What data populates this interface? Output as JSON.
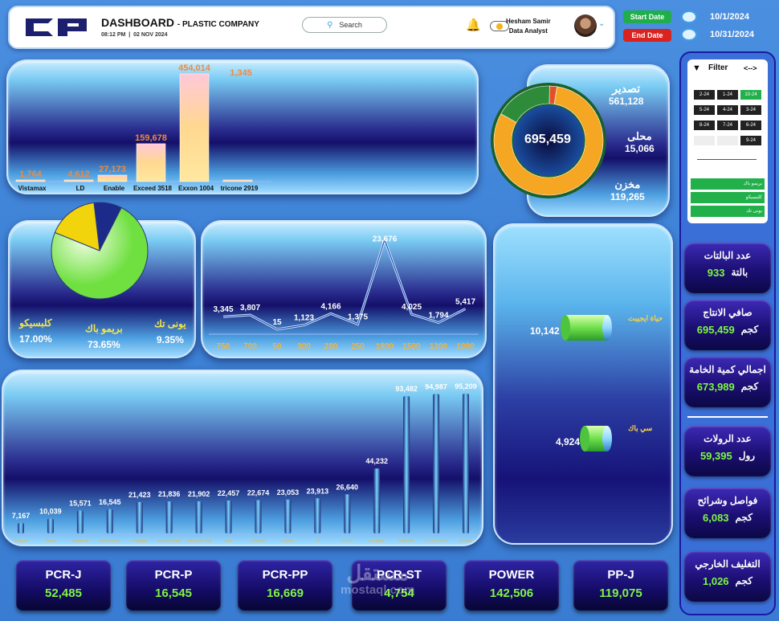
{
  "header": {
    "title": "DASHBOARD",
    "company": "- PLASTIC COMPANY",
    "time": "08:12 PM",
    "date": "02 NOV 2024",
    "search_label": "Search",
    "user_name": "Hesham Samir",
    "user_role": "Data Analyst"
  },
  "date_range": {
    "start_label": "Start Date",
    "end_label": "End Date",
    "start_value": "10/1/2024",
    "end_value": "10/31/2024",
    "start_color": "#1fae4a",
    "end_color": "#d8231f"
  },
  "filter": {
    "title": "Filter",
    "arrows": "<-->",
    "months": [
      "2-24",
      "1-24",
      "10-24",
      "5-24",
      "4-24",
      "3-24",
      "8-24",
      "7-24",
      "6-24",
      "",
      "",
      "9-24"
    ],
    "selected": "10-24",
    "items": [
      "بريمو باك",
      "كلبسيكو",
      "يونى تك"
    ]
  },
  "kpis": [
    {
      "title": "عدد البالتات",
      "value": "933",
      "unit": "بالتة"
    },
    {
      "title": "صافي الانتاج",
      "value": "695,459",
      "unit": "كجم"
    },
    {
      "title": "اجمالي كمية الخامة",
      "value": "673,989",
      "unit": "كجم"
    },
    {
      "title": "عدد الرولات",
      "value": "59,395",
      "unit": "رول"
    },
    {
      "title": "فواصل وشرائح",
      "value": "6,083",
      "unit": "كجم"
    },
    {
      "title": "التغليف الخارجي",
      "value": "1,026",
      "unit": "كجم"
    }
  ],
  "bottom_cards": [
    {
      "title": "PCR-J",
      "value": "52,485"
    },
    {
      "title": "PCR-P",
      "value": "16,545"
    },
    {
      "title": "PCR-PP",
      "value": "16,669"
    },
    {
      "title": "PCR-ST",
      "value": "4,754"
    },
    {
      "title": "POWER",
      "value": "142,506"
    },
    {
      "title": "PP-J",
      "value": "119,075"
    }
  ],
  "watermark": {
    "text": "mostaql.com",
    "arabic": "مستقل"
  },
  "donut": {
    "center_value": "695,459",
    "segments": [
      {
        "label": "تصدير",
        "value": "561,128",
        "num": 561128,
        "color": "#f5a623"
      },
      {
        "label": "محلى",
        "value": "15,066",
        "num": 15066,
        "color": "#e0502a"
      },
      {
        "label": "مخزن",
        "value": "119,265",
        "num": 119265,
        "color": "#2e8b3a"
      }
    ]
  },
  "pie": {
    "segments": [
      {
        "label": "كلبسيكو",
        "pct": "17.00%",
        "num": 17.0,
        "color": "#f2d40c"
      },
      {
        "label": "بريمو باك",
        "pct": "73.65%",
        "num": 73.65,
        "color": "#b8f58a"
      },
      {
        "label": "يونى تك",
        "pct": "9.35%",
        "num": 9.35,
        "color": "#1c2a8a"
      }
    ]
  },
  "cylinders": [
    {
      "label": "حياة ايجيبت",
      "value": "10,142"
    },
    {
      "label": "سي باك",
      "value": "4,924"
    }
  ],
  "chart_data": [
    {
      "type": "bar",
      "categories": [
        "Vistamax",
        "LD",
        "Enable",
        "Exceed 3518",
        "Exxon 1004",
        "tricone 2919"
      ],
      "values": [
        1764,
        4612,
        27173,
        159678,
        454014,
        1345
      ],
      "labels": [
        "1,764",
        "4,612",
        "27,173",
        "159,678",
        "454,014",
        "1,345"
      ]
    },
    {
      "type": "line",
      "categories": [
        "750",
        "700",
        "50",
        "300",
        "280",
        "250",
        "1800",
        "1500",
        "1300",
        "1000"
      ],
      "values": [
        3345,
        3807,
        15,
        1123,
        4166,
        1375,
        23676,
        4025,
        1794,
        5417
      ],
      "labels": [
        "3,345",
        "3,807",
        "15",
        "1,123",
        "4,166",
        "1,375",
        "23,676",
        "4,025",
        "1,794",
        "5,417"
      ]
    },
    {
      "type": "bar",
      "categories": [
        "Dubark",
        "Veres",
        "Plasticolo",
        "NOW PACK",
        "Prodigm",
        "SEADHIRAM",
        "Unilonnal Pack",
        "Amo",
        "PRIMAS",
        "Elixfeet",
        "Tit",
        "ECOS",
        "Envirope",
        "Pack Bllt",
        "ICOLOTTER",
        "Ill Pack"
      ],
      "values": [
        7167,
        10039,
        15571,
        16545,
        21423,
        21836,
        21902,
        22457,
        22674,
        23053,
        23913,
        26640,
        44232,
        93482,
        94987,
        95209
      ],
      "labels": [
        "7,167",
        "10,039",
        "15,571",
        "16,545",
        "21,423",
        "21,836",
        "21,902",
        "22,457",
        "22,674",
        "23,053",
        "23,913",
        "26,640",
        "44,232",
        "93,482",
        "94,987",
        "95,209"
      ]
    }
  ]
}
